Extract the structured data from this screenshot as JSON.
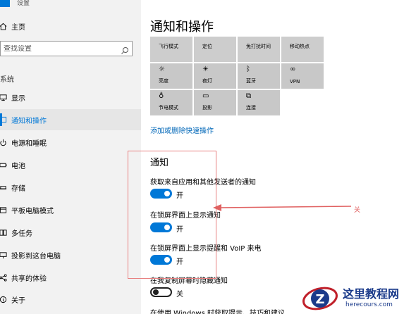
{
  "window": {
    "title": "设置"
  },
  "sidebar": {
    "home": "主页",
    "search_placeholder": "查找设置",
    "section": "系统",
    "items": [
      {
        "label": "显示",
        "icon": "monitor-icon"
      },
      {
        "label": "通知和操作",
        "icon": "notification-icon",
        "active": true
      },
      {
        "label": "电源和睡眠",
        "icon": "power-icon"
      },
      {
        "label": "电池",
        "icon": "battery-icon"
      },
      {
        "label": "存储",
        "icon": "storage-icon"
      },
      {
        "label": "平板电脑模式",
        "icon": "tablet-icon"
      },
      {
        "label": "多任务",
        "icon": "multitask-icon"
      },
      {
        "label": "投影到这台电脑",
        "icon": "project-icon"
      },
      {
        "label": "共享的体验",
        "icon": "share-icon"
      },
      {
        "label": "关于",
        "icon": "info-icon"
      }
    ]
  },
  "main": {
    "title": "通知和操作",
    "quick_actions": [
      {
        "label": "飞行模式",
        "icon": "airplane-icon"
      },
      {
        "label": "定位",
        "icon": "location-icon"
      },
      {
        "label": "免打扰时间",
        "icon": "quiet-hours-icon"
      },
      {
        "label": "移动热点",
        "icon": "hotspot-icon"
      },
      {
        "label": "亮度",
        "icon": "brightness-icon",
        "glyph": "☼"
      },
      {
        "label": "夜灯",
        "icon": "night-light-icon",
        "glyph": "☀"
      },
      {
        "label": "蓝牙",
        "icon": "bluetooth-icon",
        "glyph": "ᛒ"
      },
      {
        "label": "VPN",
        "icon": "vpn-icon",
        "glyph": "∞"
      },
      {
        "label": "节电模式",
        "icon": "battery-saver-icon",
        "glyph": "♁"
      },
      {
        "label": "投影",
        "icon": "project-icon",
        "glyph": "▭"
      },
      {
        "label": "连接",
        "icon": "connect-icon",
        "glyph": "⧉"
      }
    ],
    "edit_link": "添加或删除快速操作",
    "notifications": {
      "heading": "通知",
      "options": [
        {
          "label": "获取来自应用和其他发送者的通知",
          "state": "开",
          "on": true
        },
        {
          "label": "在锁屏界面上显示通知",
          "state": "开",
          "on": true
        },
        {
          "label": "在锁屏界面上显示提醒和 VoIP 来电",
          "state": "开",
          "on": true
        },
        {
          "label": "在我复制屏幕时隐藏通知",
          "state": "关",
          "on": false
        },
        {
          "label": "在使用 Windows 时获取提示、技巧和建议"
        }
      ]
    }
  },
  "annotation": {
    "text": "关",
    "color": "#e06060"
  },
  "watermark": {
    "title": "这里教程网",
    "url": "herecours.com"
  },
  "colors": {
    "accent": "#0078d7",
    "link": "#0067b8",
    "tile": "#c8c8c8",
    "sidebar_bg": "#f2f2f2"
  }
}
